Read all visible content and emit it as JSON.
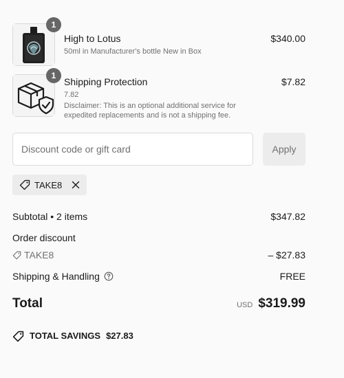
{
  "line_items": [
    {
      "name": "High to Lotus",
      "details": "50ml in Manufacturer's bottle New in Box",
      "price": "$340.00",
      "quantity": "1",
      "image": "perfume-bottle-image"
    },
    {
      "name": "Shipping Protection",
      "details": "7.82",
      "disclaimer": "Disclaimer: This is an optional additional service for expedited replacements and is not a shipping fee.",
      "price": "$7.82",
      "quantity": "1",
      "image": "package-shield-icon"
    }
  ],
  "discount": {
    "placeholder": "Discount code or gift card",
    "apply_label": "Apply",
    "applied_code": "TAKE8"
  },
  "summary": {
    "subtotal_label": "Subtotal • 2 items",
    "subtotal_value": "$347.82",
    "order_discount_label": "Order discount",
    "discount_code": "TAKE8",
    "discount_value": "– $27.83",
    "shipping_label": "Shipping & Handling",
    "shipping_value": "FREE",
    "total_label": "Total",
    "currency": "USD",
    "total_value": "$319.99",
    "savings_label": "TOTAL SAVINGS",
    "savings_value": "$27.83"
  },
  "colors": {
    "background": "#fafafa",
    "badge": "#666666",
    "muted_text": "#707070",
    "button_bg": "#ececec"
  }
}
